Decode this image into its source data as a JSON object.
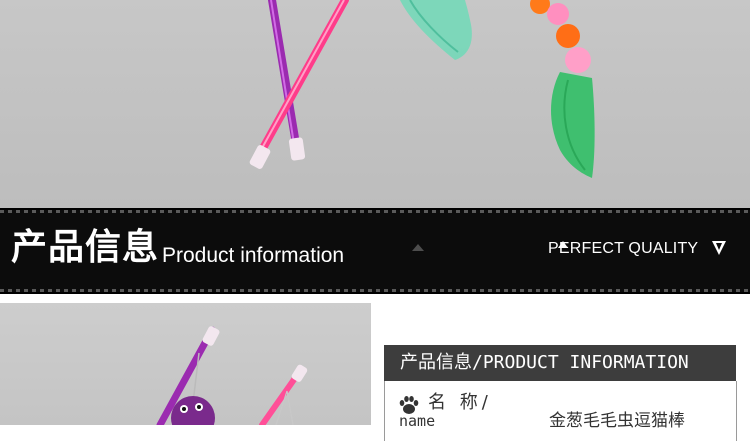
{
  "banner": {
    "title_cn": "产品信息",
    "title_en": "Product information",
    "tagline": "PERFECT QUALITY"
  },
  "info": {
    "header": "产品信息/PRODUCT INFORMATION",
    "name_label_cn": "名 称/",
    "name_label_en": "name",
    "name_value": "金葱毛毛虫逗猫棒"
  },
  "icons": {
    "banner_arrow": "down-arrow-icon",
    "name_icon": "paw-icon"
  },
  "colors": {
    "banner_bg": "#0c0c0c",
    "info_header_bg": "#3d3d3d",
    "photo_bg": "#c4c4c4"
  }
}
